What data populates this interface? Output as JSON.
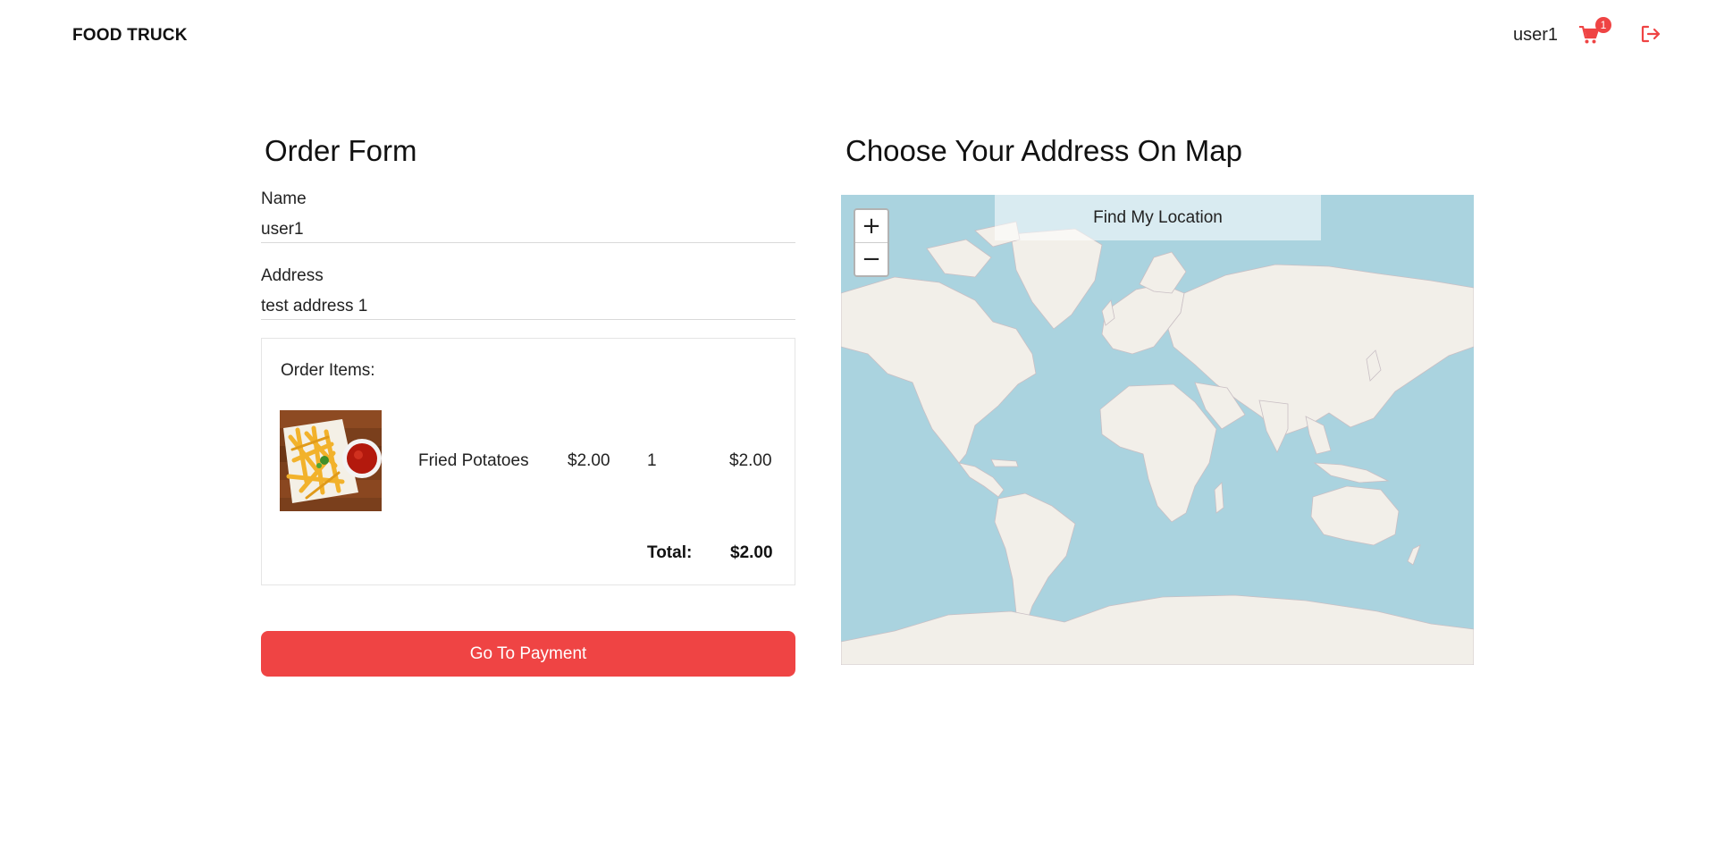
{
  "header": {
    "brand": "FOOD TRUCK",
    "username": "user1",
    "cart_count": "1",
    "cart_icon": "cart-icon",
    "logout_icon": "logout-icon"
  },
  "order_form": {
    "title": "Order Form",
    "name_label": "Name",
    "name_value": "user1",
    "address_label": "Address",
    "address_value": "test address 1",
    "items_title": "Order Items:",
    "items": [
      {
        "name": "Fried Potatoes",
        "price": "$2.00",
        "quantity": "1",
        "subtotal": "$2.00"
      }
    ],
    "total_label": "Total:",
    "total_value": "$2.00",
    "payment_button": "Go To Payment"
  },
  "map": {
    "title": "Choose Your Address On Map",
    "find_location_button": "Find My Location",
    "zoom_in": "+",
    "zoom_out": "−"
  },
  "colors": {
    "accent": "#ef4444",
    "water": "#aad3df",
    "land": "#f2efe9"
  }
}
